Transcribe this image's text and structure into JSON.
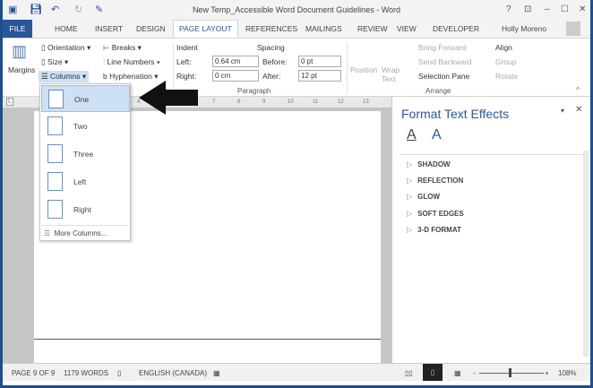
{
  "window": {
    "title": "New Temp_Accessible Word Document Guidelines - Word",
    "user": "Holly Moreno"
  },
  "tabs": [
    "FILE",
    "HOME",
    "INSERT",
    "DESIGN",
    "PAGE LAYOUT",
    "REFERENCES",
    "MAILINGS",
    "REVIEW",
    "VIEW",
    "DEVELOPER"
  ],
  "ribbon": {
    "margins": "Margins",
    "orientation": "Orientation",
    "size": "Size",
    "columns": "Columns",
    "breaks": "Breaks",
    "line_numbers": "Line Numbers",
    "hyphenation": "Hyphenation",
    "indent": "Indent",
    "left_label": "Left:",
    "left_value": "0.64 cm",
    "right_label": "Right:",
    "right_value": "0 cm",
    "spacing": "Spacing",
    "before_label": "Before:",
    "before_value": "0 pt",
    "after_label": "After:",
    "after_value": "12 pt",
    "paragraph": "Paragraph",
    "position": "Position",
    "wrap_text": "Wrap Text",
    "bring_forward": "Bring Forward",
    "send_backward": "Send Backward",
    "selection_pane": "Selection Pane",
    "align": "Align",
    "group": "Group",
    "rotate": "Rotate",
    "arrange": "Arrange"
  },
  "ruler_ticks": [
    "4",
    "7",
    "8",
    "9",
    "10",
    "11",
    "12",
    "13"
  ],
  "columns_menu": {
    "items": [
      "One",
      "Two",
      "Three",
      "Left",
      "Right"
    ],
    "selected": "One",
    "more": "More Columns..."
  },
  "panel": {
    "title": "Format Text Effects",
    "sections": [
      "SHADOW",
      "REFLECTION",
      "GLOW",
      "SOFT EDGES",
      "3-D FORMAT"
    ]
  },
  "status": {
    "page": "PAGE 9 OF 9",
    "words": "1179 WORDS",
    "language": "ENGLISH (CANADA)",
    "zoom": "108%",
    "zoom_level": 108
  },
  "colors": {
    "accent": "#2b579a",
    "frame": "#1d4f8a"
  }
}
